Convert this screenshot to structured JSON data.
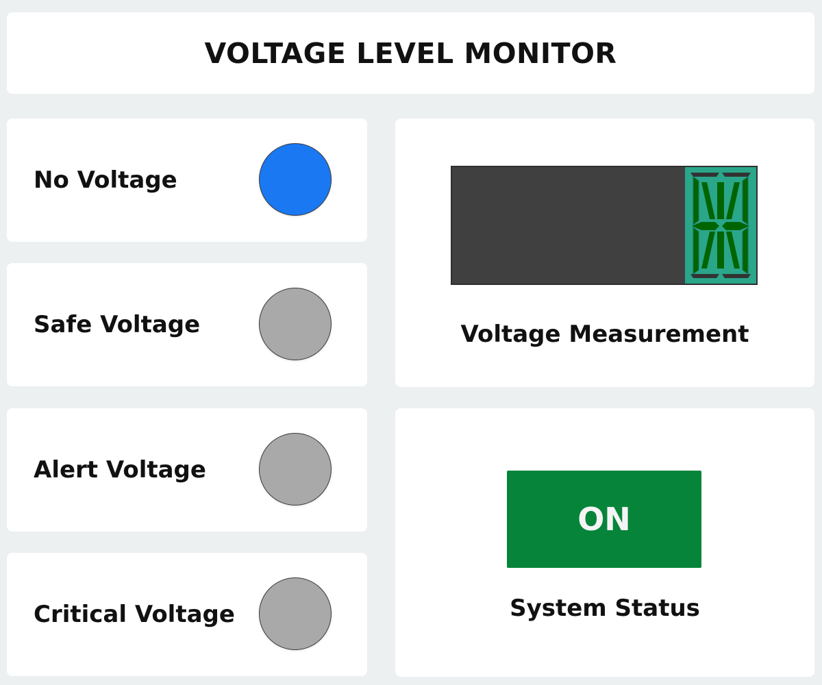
{
  "header": {
    "title": "VOLTAGE LEVEL MONITOR"
  },
  "indicators": [
    {
      "label": "No Voltage",
      "state": "active",
      "color": "#1a78f2"
    },
    {
      "label": "Safe Voltage",
      "state": "inactive",
      "color": "#a9a9a9"
    },
    {
      "label": "Alert Voltage",
      "state": "inactive",
      "color": "#a9a9a9"
    },
    {
      "label": "Critical Voltage",
      "state": "inactive",
      "color": "#a9a9a9"
    }
  ],
  "measurement": {
    "label": "Voltage Measurement",
    "display_bg": "#404040",
    "segment_off_color": "#2aa68a",
    "segment_on_color": "#006400"
  },
  "status": {
    "button_label": "ON",
    "button_color": "#06853a",
    "label": "System Status"
  }
}
